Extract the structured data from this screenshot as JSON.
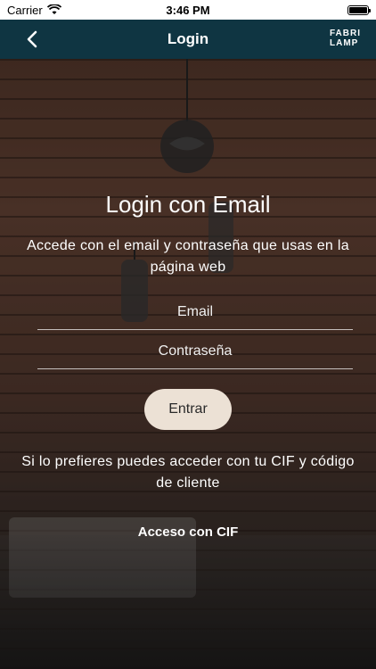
{
  "status_bar": {
    "carrier": "Carrier",
    "time": "3:46 PM"
  },
  "nav": {
    "title": "Login",
    "brand_line1": "FABRI",
    "brand_line2": "LAMP"
  },
  "login": {
    "title": "Login con Email",
    "subtitle": "Accede con el email y contraseña que usas en la página web",
    "email_placeholder": "Email",
    "password_placeholder": "Contraseña",
    "enter_label": "Entrar",
    "cif_text": "Si lo prefieres puedes acceder con tu CIF y código de cliente",
    "cif_link": "Acceso con CIF"
  },
  "colors": {
    "nav_bg": "#0f3542",
    "button_bg": "#ece1d5"
  }
}
